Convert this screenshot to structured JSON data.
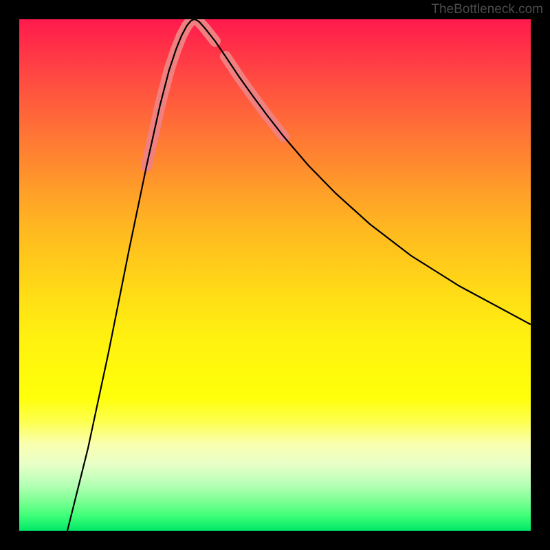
{
  "watermark": "TheBottleneck.com",
  "chart_data": {
    "type": "line",
    "title": "",
    "xlabel": "",
    "ylabel": "",
    "xlim": [
      0,
      1000
    ],
    "ylim": [
      0,
      744
    ],
    "series": [
      {
        "name": "curve",
        "x": [
          70,
          100,
          130,
          160,
          185,
          205,
          218,
          228,
          236,
          244,
          250,
          256,
          262,
          270,
          285,
          300,
          320,
          340,
          360,
          385,
          420,
          460,
          510,
          570,
          640,
          744
        ],
        "y": [
          0,
          120,
          260,
          410,
          530,
          620,
          670,
          700,
          720,
          735,
          742,
          744,
          740,
          731,
          712,
          690,
          660,
          632,
          605,
          573,
          532,
          491,
          446,
          400,
          356,
          300
        ]
      }
    ],
    "highlight_segments": [
      {
        "x": [
          185,
          205
        ],
        "y": [
          530,
          620
        ]
      },
      {
        "x": [
          205,
          218
        ],
        "y": [
          620,
          670
        ]
      },
      {
        "x": [
          218,
          228
        ],
        "y": [
          670,
          700
        ]
      },
      {
        "x": [
          228,
          236
        ],
        "y": [
          700,
          720
        ]
      },
      {
        "x": [
          236,
          244
        ],
        "y": [
          720,
          735
        ]
      },
      {
        "x": [
          244,
          250
        ],
        "y": [
          735,
          742
        ]
      },
      {
        "x": [
          262,
          270
        ],
        "y": [
          740,
          731
        ]
      },
      {
        "x": [
          270,
          285
        ],
        "y": [
          731,
          712
        ]
      },
      {
        "x": [
          300,
          320
        ],
        "y": [
          690,
          660
        ]
      },
      {
        "x": [
          320,
          340
        ],
        "y": [
          660,
          632
        ]
      },
      {
        "x": [
          340,
          360
        ],
        "y": [
          632,
          605
        ]
      },
      {
        "x": [
          360,
          385
        ],
        "y": [
          605,
          573
        ]
      }
    ]
  }
}
